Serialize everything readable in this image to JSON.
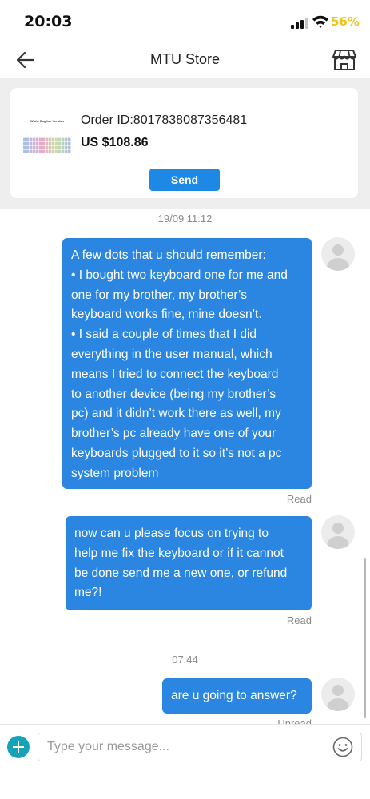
{
  "status_bar": {
    "time": "20:03",
    "battery_percent": "56%",
    "battery_color": "#f0c419",
    "signal_icon": "signal-icon",
    "wifi_icon": "wifi-icon"
  },
  "header": {
    "title": "MTU Store",
    "back_icon": "back-arrow-icon",
    "store_icon": "store-icon"
  },
  "order_card": {
    "thumbnail_caption": "White English Version",
    "order_id": "Order ID:8017838087356481",
    "price": "US $108.86",
    "send_label": "Send"
  },
  "chat": {
    "accent_color": "#2a86e0",
    "messages": [
      {
        "timestamp": "19/09 11:12",
        "lines": [
          "A few dots that u should remember:",
          "• I bought two keyboard one for me and",
          "one for my brother, my brother’s",
          "keyboard works fine, mine doesn’t.",
          "• I said a couple of times that I did",
          "everything in the user manual, which",
          "means I tried to connect the keyboard",
          "to another device (being my brother’s",
          "pc) and it didn’t work there as well, my",
          "brother’s pc already have one of your",
          "keyboards plugged to it so it’s not a pc",
          "system problem"
        ],
        "status": "Read"
      },
      {
        "lines": [
          "now can u please focus on trying to",
          "help me fix the keyboard or if it cannot",
          "be done send me a new one, or refund",
          "me?!"
        ],
        "status": "Read"
      },
      {
        "timestamp": "07:44",
        "lines": [
          "are u going to answer?"
        ],
        "status": "Unread"
      }
    ]
  },
  "input": {
    "placeholder": "Type your message...",
    "add_icon": "plus-icon",
    "emoji_icon": "emoji-icon"
  }
}
